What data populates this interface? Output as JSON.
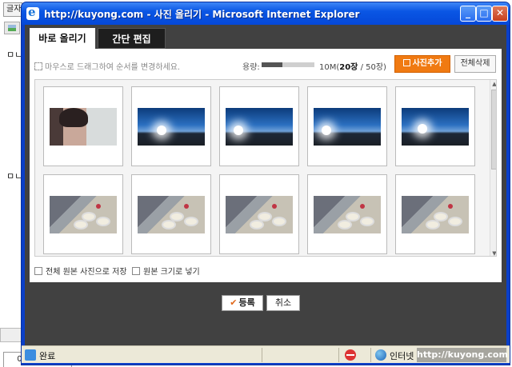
{
  "background": {
    "tab_text": "글자",
    "bullet_1": "ㅁㄴ",
    "bullet_2": "ㅁㄴ",
    "bottom_tab": "이전할 방기"
  },
  "window": {
    "title": "http://kuyong.com - 사진 올리기 - Microsoft Internet Explorer",
    "minimize": "_",
    "maximize": "□",
    "close": "✕"
  },
  "tabs": [
    {
      "label": "바로 올리기",
      "active": true
    },
    {
      "label": "간단 편집",
      "active": false
    }
  ],
  "toolbar": {
    "hint": "마우스로 드래그하여 순서를 변경하세요.",
    "capacity_label": "용량:",
    "capacity_fraction": 0.4,
    "capacity_prefix": "10M(",
    "capacity_count": "20장",
    "capacity_suffix": " / 50장)",
    "add_photo": "사진추가",
    "delete_all": "전체삭제"
  },
  "photos": [
    {
      "kind": "face"
    },
    {
      "kind": "sky"
    },
    {
      "kind": "sky"
    },
    {
      "kind": "sky"
    },
    {
      "kind": "sky"
    },
    {
      "kind": "food"
    },
    {
      "kind": "food"
    },
    {
      "kind": "food"
    },
    {
      "kind": "food"
    },
    {
      "kind": "food"
    }
  ],
  "options": {
    "save_original": "전체 원본 사진으로 저장",
    "original_size": "원본 크기로 넣기"
  },
  "actions": {
    "register": "등록",
    "cancel": "취소"
  },
  "status": {
    "text": "완료",
    "zone": "인터넷",
    "watermark": "http://kuyong.com"
  },
  "colors": {
    "accent_orange": "#f07a12",
    "title_blue": "#0a56e4",
    "dark_panel": "#414141"
  }
}
